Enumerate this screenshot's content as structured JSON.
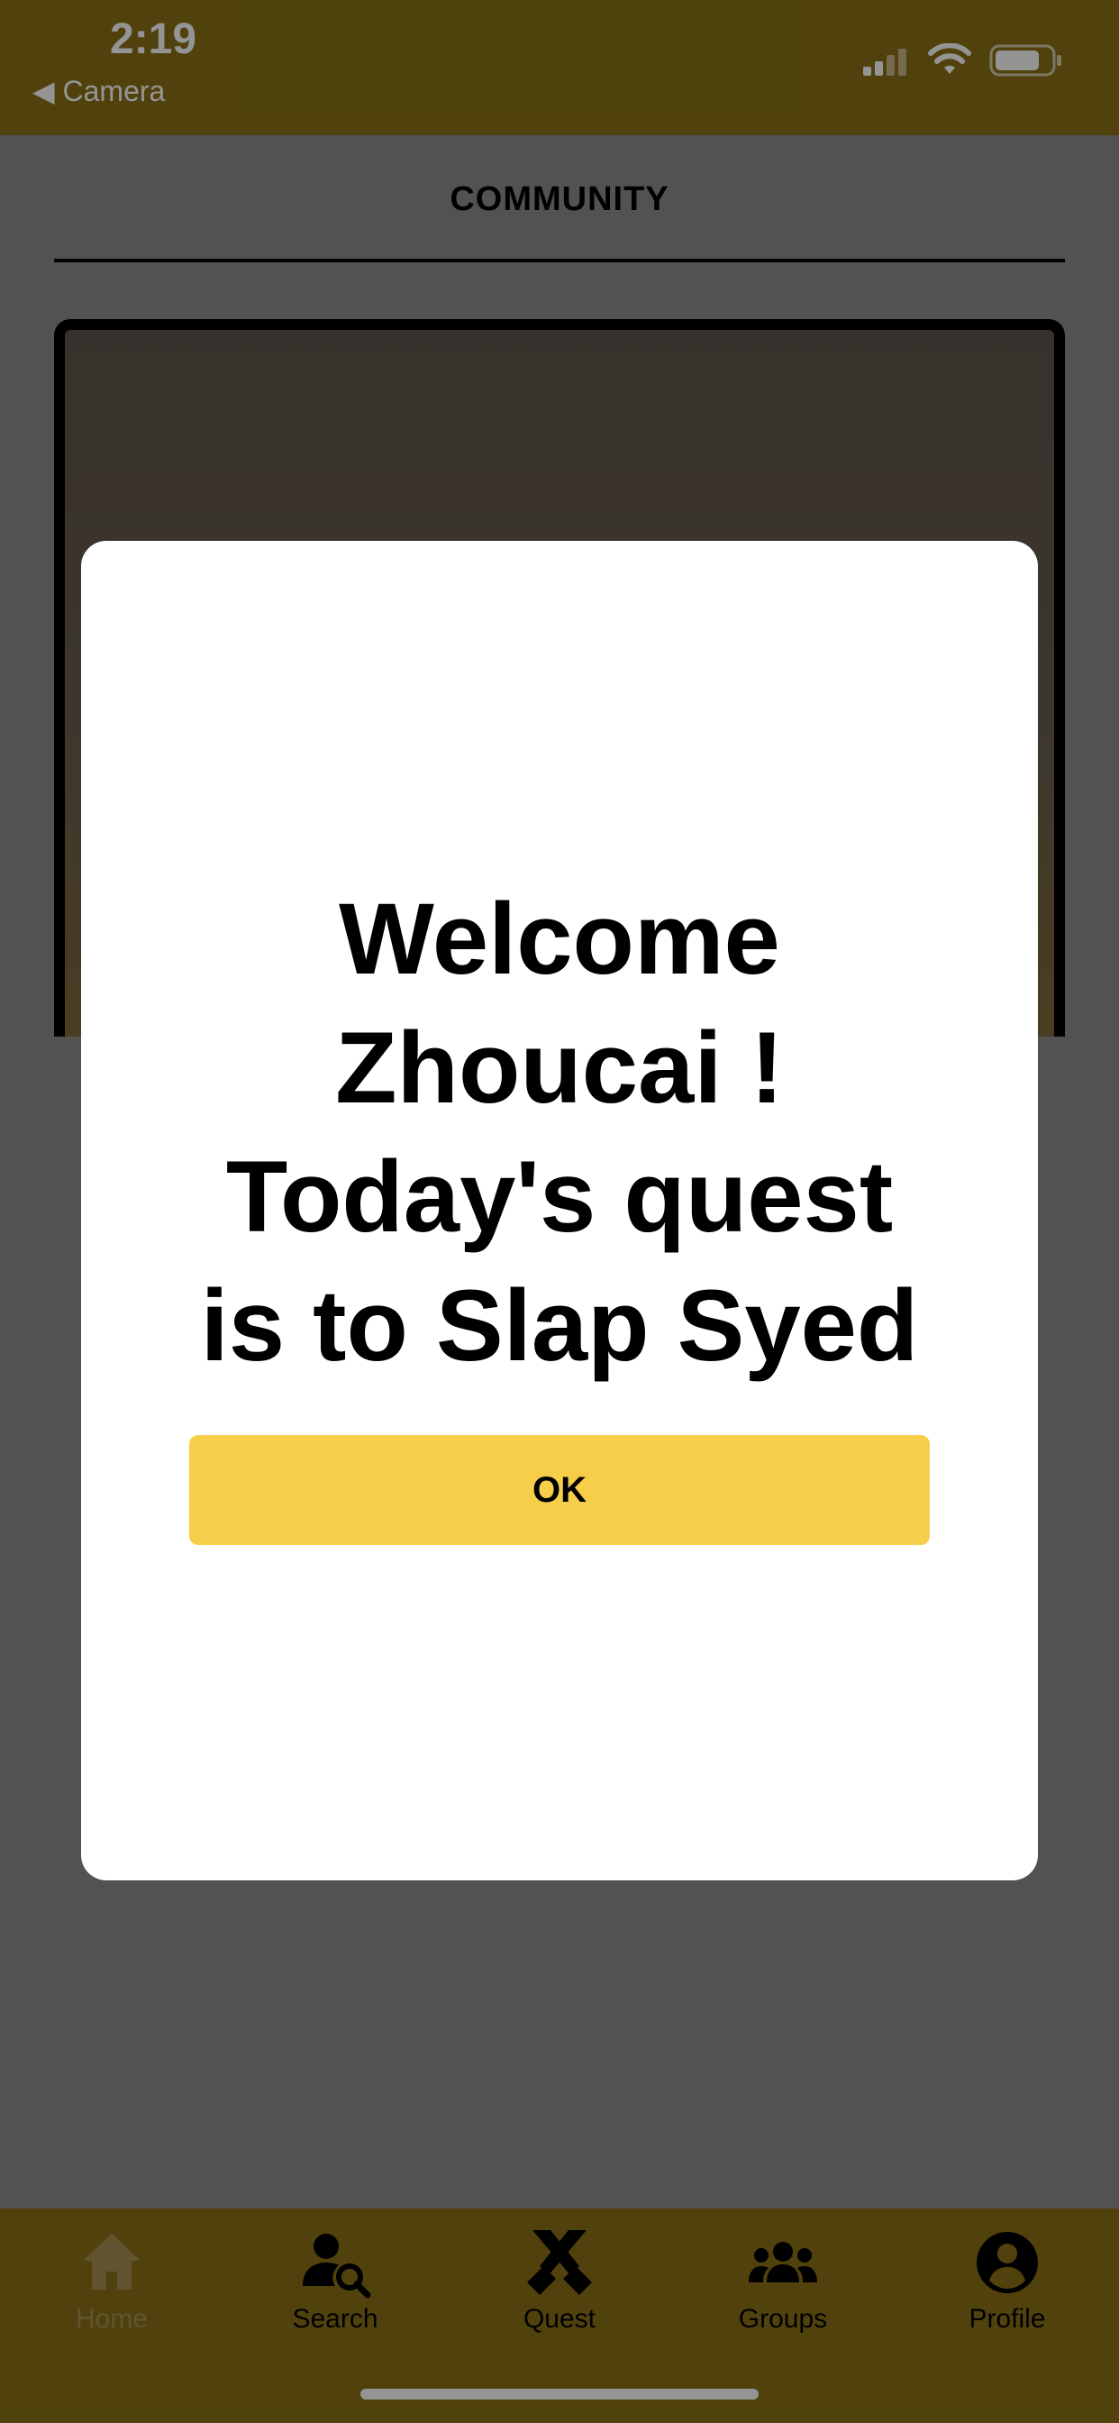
{
  "status_bar": {
    "time": "2:19",
    "back_label": "◀ Camera"
  },
  "page": {
    "section_title": "COMMUNITY"
  },
  "modal": {
    "line1": "Welcome",
    "line2": "Zhoucai !",
    "line3": "Today's quest",
    "line4": "is to Slap Syed",
    "ok_label": "OK"
  },
  "tabs": [
    {
      "label": "Home",
      "icon": "home-icon"
    },
    {
      "label": "Search",
      "icon": "user-search-icon"
    },
    {
      "label": "Quest",
      "icon": "crossed-swords-icon"
    },
    {
      "label": "Groups",
      "icon": "groups-icon"
    },
    {
      "label": "Profile",
      "icon": "profile-icon"
    }
  ],
  "colors": {
    "bar": "#8c7318",
    "ok_button": "#f7ce4a"
  }
}
